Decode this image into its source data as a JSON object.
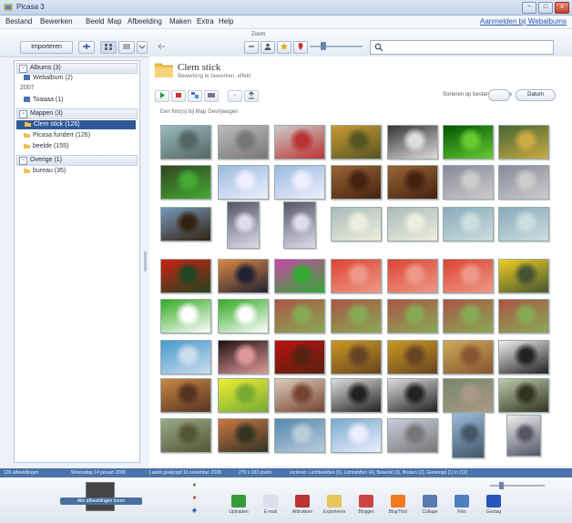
{
  "window": {
    "title": "Picasa 3",
    "min": "−",
    "max": "□",
    "close": "x"
  },
  "menu": {
    "items": [
      "Bestand",
      "Bewerken",
      "Beeld",
      "Map",
      "Afbeelding",
      "Maken",
      "Extra",
      "Help"
    ],
    "signin": "Aanmelden bij Webalbums"
  },
  "toolbar": {
    "import_label": "Importeren",
    "zoom_label": "Zoom",
    "search_placeholder": ""
  },
  "sidebar": {
    "albums": {
      "label": "Albums (3)",
      "items": [
        {
          "label": "Webalbum (2)"
        }
      ]
    },
    "year_label": "2007",
    "year_items": [
      {
        "label": "Toaaaa (1)"
      }
    ],
    "folders": {
      "label": "Mappen (3)",
      "items": [
        {
          "label": "Clem stick (126)",
          "selected": true
        },
        {
          "label": "Picasa fundert (126)",
          "selected": false
        },
        {
          "label": "beelde (155)",
          "selected": false
        }
      ]
    },
    "other": {
      "label": "Overige (1)",
      "items": [
        {
          "label": "bureau (35)"
        }
      ]
    }
  },
  "main": {
    "folder_title": "Clem stick",
    "folder_subtitle": "Bewerking te bewerken, effekt",
    "sort_label": "Sorteren op bestandsgrootte",
    "sort_button": "Datum",
    "select_hint": "Een foto(s) bij Map Gevrijwagen"
  },
  "status": {
    "segments": [
      "126 afbeeldingen",
      "Woensdag 14 januari 2009",
      "Laatst gewijzigd 16 november 2008",
      "275 x 183 pixels",
      "sorteren: Lichtbeelden (5), Lichtstoffen (4), Bewerkt (3), Brunen (2), Gemengd (1) in (12)"
    ]
  },
  "tray": {
    "preview_label": "Alle afbeeldingen tonen",
    "tools": [
      "Uploaden",
      "E-mail",
      "Afdrukken",
      "Exporteren",
      "Blogger",
      "BlogThis!",
      "Collage",
      "Film",
      "Geotag"
    ]
  },
  "colors": {
    "selection": "#2f5a97",
    "status_bar": "#4b74aa",
    "title_bar": "#c4d4ea"
  },
  "thumbnails": [
    {
      "kind": "statue"
    },
    {
      "kind": "rocks"
    },
    {
      "kind": "grey-ladybug"
    },
    {
      "kind": "autumn"
    },
    {
      "kind": "window"
    },
    {
      "kind": "green-fireworks"
    },
    {
      "kind": "garden"
    },
    {
      "kind": "garden-dark"
    },
    {
      "kind": "sky"
    },
    {
      "kind": "sky"
    },
    {
      "kind": "wood"
    },
    {
      "kind": "wood"
    },
    {
      "kind": "rocks-grey"
    },
    {
      "kind": "rocks-grey"
    },
    {
      "kind": "lake"
    },
    {
      "kind": "winter-tall"
    },
    {
      "kind": "winter-tall"
    },
    {
      "kind": "beach"
    },
    {
      "kind": "beach"
    },
    {
      "kind": "sea"
    },
    {
      "kind": "sea"
    },
    {
      "kind": "red-flower"
    },
    {
      "kind": "sunset"
    },
    {
      "kind": "pink-flower"
    },
    {
      "kind": "red-dots"
    },
    {
      "kind": "red-dots"
    },
    {
      "kind": "red-dots"
    },
    {
      "kind": "yellow-flower"
    },
    {
      "kind": "plants"
    },
    {
      "kind": "plants"
    },
    {
      "kind": "butterfly"
    },
    {
      "kind": "butterfly"
    },
    {
      "kind": "butterfly"
    },
    {
      "kind": "butterfly"
    },
    {
      "kind": "butterfly"
    },
    {
      "kind": "water"
    },
    {
      "kind": "baby"
    },
    {
      "kind": "red-flower-2"
    },
    {
      "kind": "golden"
    },
    {
      "kind": "golden"
    },
    {
      "kind": "golden-2"
    },
    {
      "kind": "swan"
    },
    {
      "kind": "warm-room"
    },
    {
      "kind": "daffodil"
    },
    {
      "kind": "woman"
    },
    {
      "kind": "gate"
    },
    {
      "kind": "gate"
    },
    {
      "kind": "maze"
    },
    {
      "kind": "butterfly-2"
    },
    {
      "kind": "landscape"
    },
    {
      "kind": "sunset-2"
    },
    {
      "kind": "lake-blue"
    },
    {
      "kind": "harbor"
    },
    {
      "kind": "statue-2"
    },
    {
      "kind": "tower"
    },
    {
      "kind": "globe"
    }
  ]
}
